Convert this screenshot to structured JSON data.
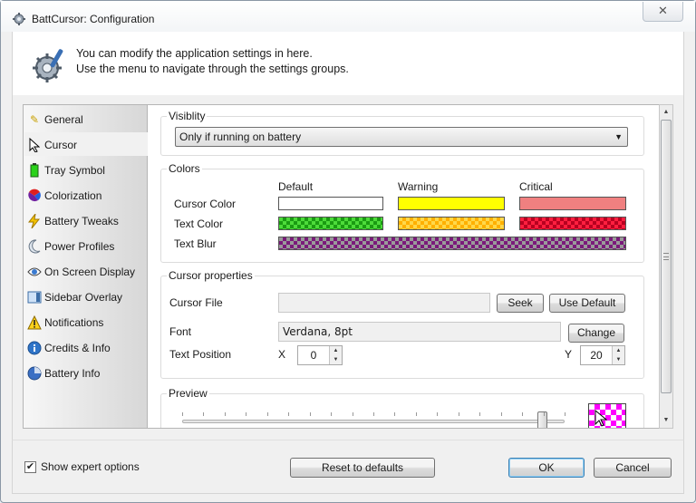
{
  "window": {
    "title": "BattCursor: Configuration",
    "close_symbol": "✕"
  },
  "header": {
    "line1": "You can modify the application settings in here.",
    "line2": "Use the menu to navigate through the settings groups."
  },
  "sidebar": {
    "items": [
      {
        "label": "General",
        "icon": "pencil-icon"
      },
      {
        "label": "Cursor",
        "icon": "cursor-icon",
        "selected": true
      },
      {
        "label": "Tray Symbol",
        "icon": "battery-icon"
      },
      {
        "label": "Colorization",
        "icon": "color-wheel-icon"
      },
      {
        "label": "Battery Tweaks",
        "icon": "lightning-icon"
      },
      {
        "label": "Power Profiles",
        "icon": "moon-icon"
      },
      {
        "label": "On Screen Display",
        "icon": "eye-icon"
      },
      {
        "label": "Sidebar Overlay",
        "icon": "sidebar-icon"
      },
      {
        "label": "Notifications",
        "icon": "warning-icon"
      },
      {
        "label": "Credits & Info",
        "icon": "info-icon"
      },
      {
        "label": "Battery Info",
        "icon": "pie-chart-icon"
      }
    ]
  },
  "visibility": {
    "label": "Visiblity",
    "selected": "Only if running on battery"
  },
  "colors": {
    "label": "Colors",
    "columns": [
      "Default",
      "Warning",
      "Critical"
    ],
    "rows": [
      "Cursor Color",
      "Text Color",
      "Text Blur"
    ],
    "swatches": {
      "cursor_default": "#ffffff",
      "cursor_warning": "#ffff00",
      "cursor_critical": "#f08080"
    }
  },
  "cursor_properties": {
    "label": "Cursor properties",
    "file_label": "Cursor File",
    "file_value": "",
    "seek_button": "Seek",
    "use_default_button": "Use Default",
    "font_label": "Font",
    "font_value": "Verdana, 8pt",
    "change_button": "Change",
    "text_position_label": "Text Position",
    "x_label": "X",
    "x_value": "0",
    "y_label": "Y",
    "y_value": "20"
  },
  "preview": {
    "label": "Preview",
    "slider_value_fraction": 0.94
  },
  "footer": {
    "expert_label": "Show expert options",
    "expert_checked": true,
    "reset_button": "Reset to defaults",
    "ok_button": "OK",
    "cancel_button": "Cancel"
  }
}
